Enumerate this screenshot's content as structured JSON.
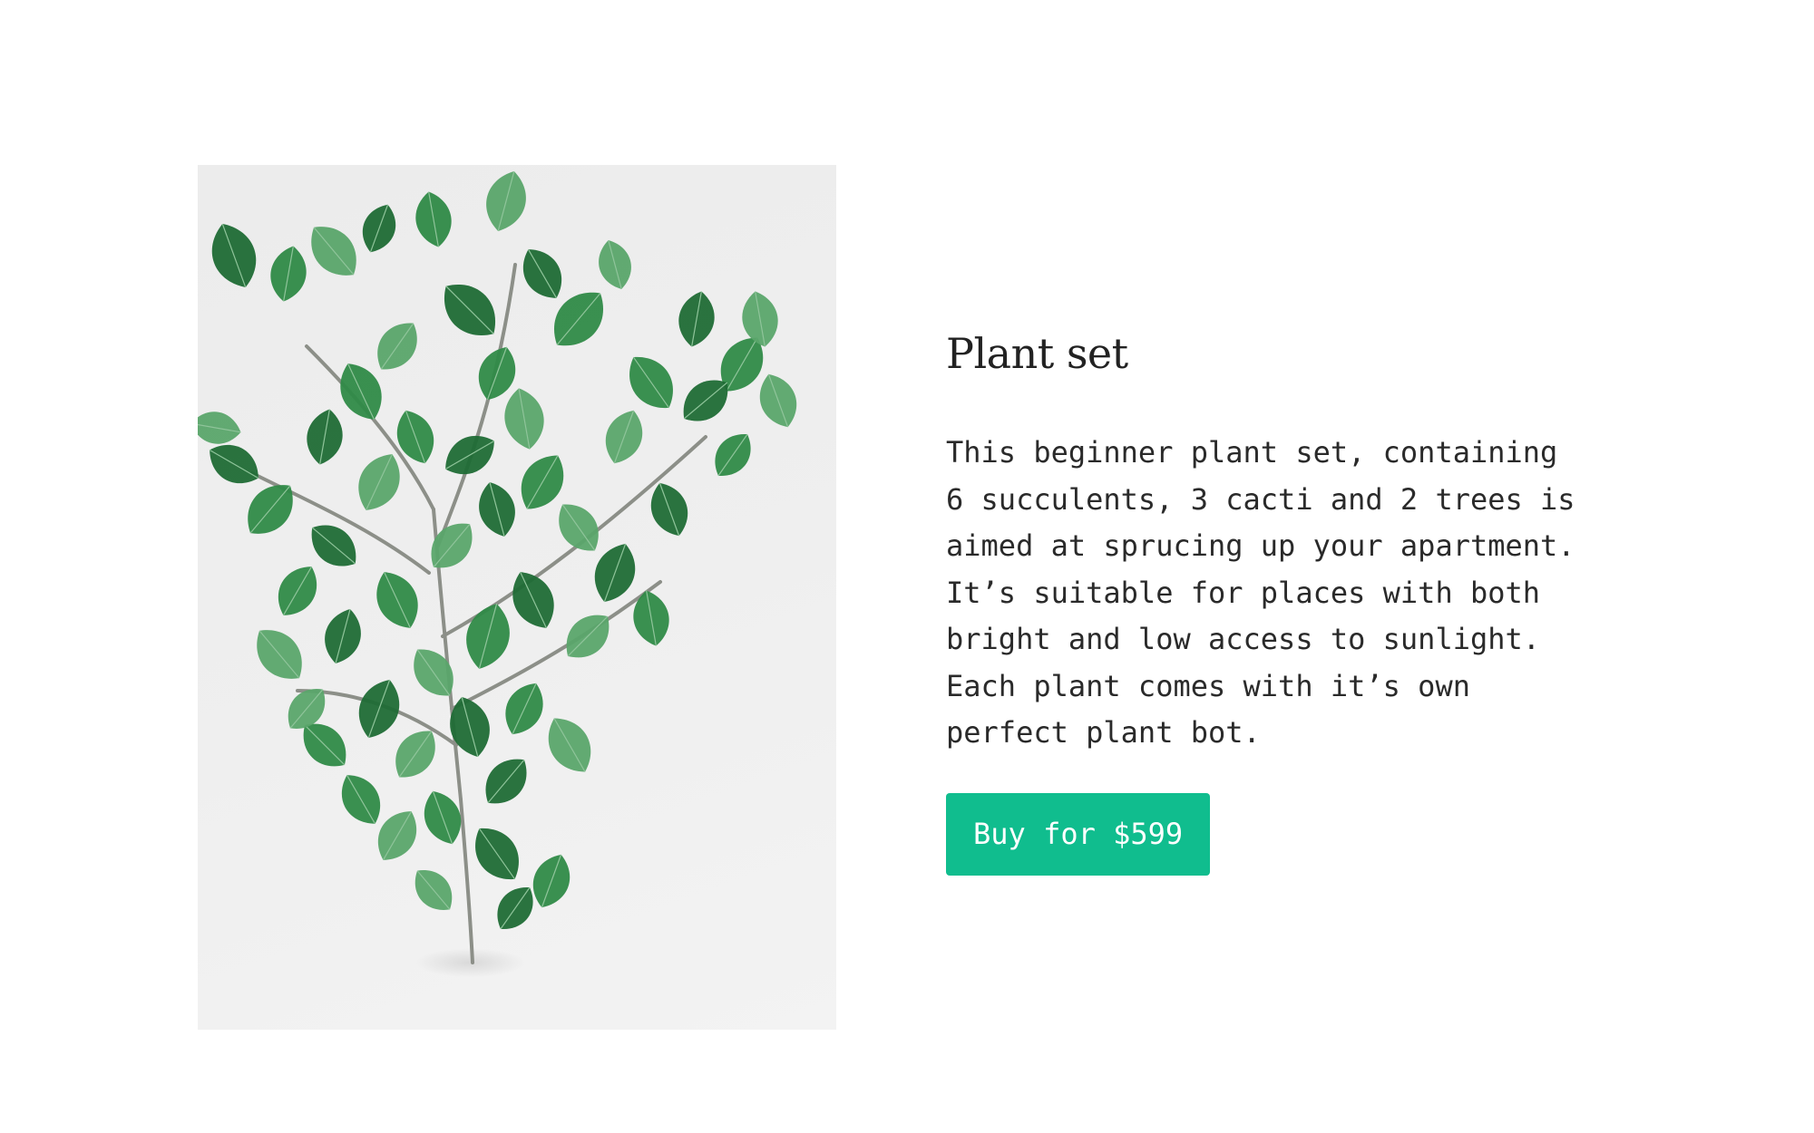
{
  "product": {
    "title": "Plant set",
    "description": "This beginner plant set, containing\n6 succulents, 3 cacti and 2 trees is\naimed at sprucing up your apartment.\nIt’s suitable for places with both\nbright and low access to sunlight.\nEach plant comes with it’s own\nperfect plant bot.",
    "buy_label": "Buy for $599",
    "image_icon": "plant-photo"
  },
  "colors": {
    "accent": "#10bd8e",
    "text": "#222222",
    "background": "#ffffff",
    "leaf_dark": "#1f6b35",
    "leaf_mid": "#2f8a47",
    "leaf_light": "#5aa56a"
  }
}
